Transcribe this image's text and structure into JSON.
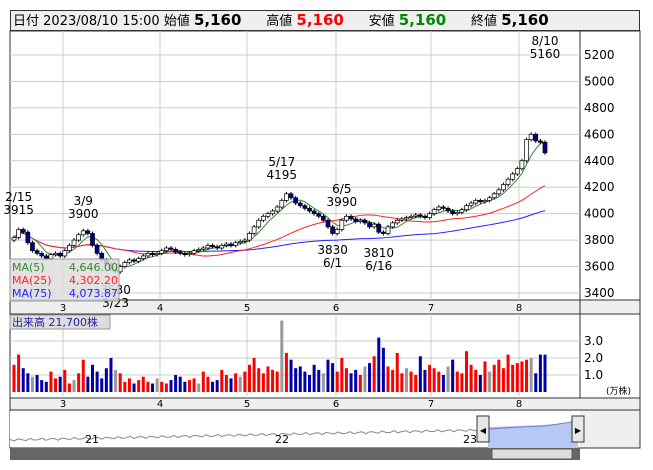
{
  "header": {
    "date_label": "日付",
    "date": "2023/08/10 15:00",
    "open_label": "始値",
    "open": "5,160",
    "high_label": "高値",
    "high": "5,160",
    "low_label": "安値",
    "low": "5,160",
    "close_label": "終値",
    "close": "5,160"
  },
  "colors": {
    "up": "#ff0000",
    "down": "#0000cc",
    "ma5": "#338833",
    "ma25": "#ff2222",
    "ma75": "#2222ff"
  },
  "legend": {
    "ma5_label": "MA(5)",
    "ma5": "4,646.00",
    "ma25_label": "MA(25)",
    "ma25": "4,302.20",
    "ma75_label": "MA(75)",
    "ma75": "4,073.87"
  },
  "volume_label": "出来高",
  "volume_value": "21,700株",
  "volume_unit": "(万株)",
  "navigator": {
    "labels": [
      "21",
      "22",
      "23"
    ]
  },
  "chart_data": {
    "type": "candlestick",
    "y_ticks": [
      3400,
      3600,
      3800,
      4000,
      4200,
      4400,
      4600,
      4800,
      5000,
      5200
    ],
    "ylim": [
      3400,
      5200
    ],
    "month_labels": [
      "3",
      "4",
      "5",
      "6",
      "7",
      "8"
    ],
    "vol_ticks": [
      "1.0",
      "2.0",
      "3.0"
    ],
    "vol_lim": [
      0,
      4.4
    ],
    "annotations": [
      {
        "label": "2/15",
        "value": "3915",
        "i": 1
      },
      {
        "label": "3/9",
        "value": "3900",
        "i": 15
      },
      {
        "label": "3/23",
        "value": "3530",
        "i": 22
      },
      {
        "label": "5/17",
        "value": "4195",
        "i": 58
      },
      {
        "label": "6/1",
        "value": "3830",
        "i": 69
      },
      {
        "label": "6/5",
        "value": "3990",
        "i": 71
      },
      {
        "label": "6/16",
        "value": "3810",
        "i": 79
      },
      {
        "label": "8/10",
        "value": "5160",
        "i": 115
      }
    ],
    "closes": [
      3820,
      3880,
      3860,
      3780,
      3720,
      3700,
      3680,
      3660,
      3690,
      3700,
      3680,
      3720,
      3760,
      3800,
      3840,
      3870,
      3850,
      3760,
      3700,
      3650,
      3620,
      3580,
      3560,
      3600,
      3630,
      3650,
      3640,
      3660,
      3680,
      3700,
      3690,
      3700,
      3720,
      3740,
      3730,
      3710,
      3700,
      3690,
      3700,
      3720,
      3730,
      3740,
      3760,
      3750,
      3740,
      3760,
      3770,
      3760,
      3780,
      3790,
      3800,
      3850,
      3900,
      3950,
      3980,
      4000,
      4020,
      4050,
      4100,
      4150,
      4120,
      4080,
      4060,
      4040,
      4020,
      4000,
      3980,
      3950,
      3900,
      3850,
      3880,
      3950,
      3980,
      3960,
      3940,
      3950,
      3930,
      3900,
      3920,
      3860,
      3850,
      3900,
      3930,
      3950,
      3960,
      3970,
      3980,
      3990,
      3980,
      3970,
      4000,
      4030,
      4050,
      4040,
      4020,
      4000,
      4010,
      4030,
      4060,
      4080,
      4100,
      4090,
      4100,
      4120,
      4150,
      4180,
      4220,
      4260,
      4300,
      4340,
      4400,
      4560,
      4600,
      4550,
      4540,
      4460
    ],
    "volumes": [
      1.6,
      2.2,
      1.4,
      1.1,
      0.9,
      1.0,
      0.7,
      0.6,
      1.2,
      0.8,
      0.9,
      1.3,
      0.5,
      0.7,
      1.1,
      1.9,
      0.9,
      1.6,
      1.2,
      0.8,
      1.4,
      2.0,
      1.3,
      1.1,
      0.6,
      0.8,
      0.5,
      0.7,
      0.9,
      0.6,
      0.5,
      0.8,
      0.6,
      0.5,
      0.7,
      1.0,
      0.9,
      0.6,
      0.7,
      0.8,
      0.5,
      1.2,
      0.9,
      0.6,
      0.7,
      1.3,
      1.0,
      0.8,
      1.1,
      0.9,
      1.2,
      1.6,
      2.0,
      1.4,
      1.1,
      1.5,
      1.3,
      1.2,
      4.2,
      2.3,
      1.9,
      1.4,
      1.5,
      1.2,
      1.0,
      1.6,
      1.3,
      1.1,
      1.9,
      1.7,
      1.2,
      2.0,
      1.4,
      1.1,
      1.3,
      1.0,
      1.5,
      1.7,
      2.1,
      3.2,
      2.6,
      1.5,
      1.3,
      2.3,
      1.1,
      1.4,
      1.2,
      1.0,
      2.1,
      1.3,
      1.6,
      1.4,
      1.2,
      1.0,
      1.5,
      1.9,
      1.2,
      1.1,
      2.4,
      1.6,
      1.3,
      1.0,
      1.8,
      1.2,
      1.6,
      1.9,
      1.4,
      2.2,
      1.6,
      1.7,
      1.8,
      1.9,
      2.0,
      1.1,
      2.2,
      2.2
    ]
  }
}
